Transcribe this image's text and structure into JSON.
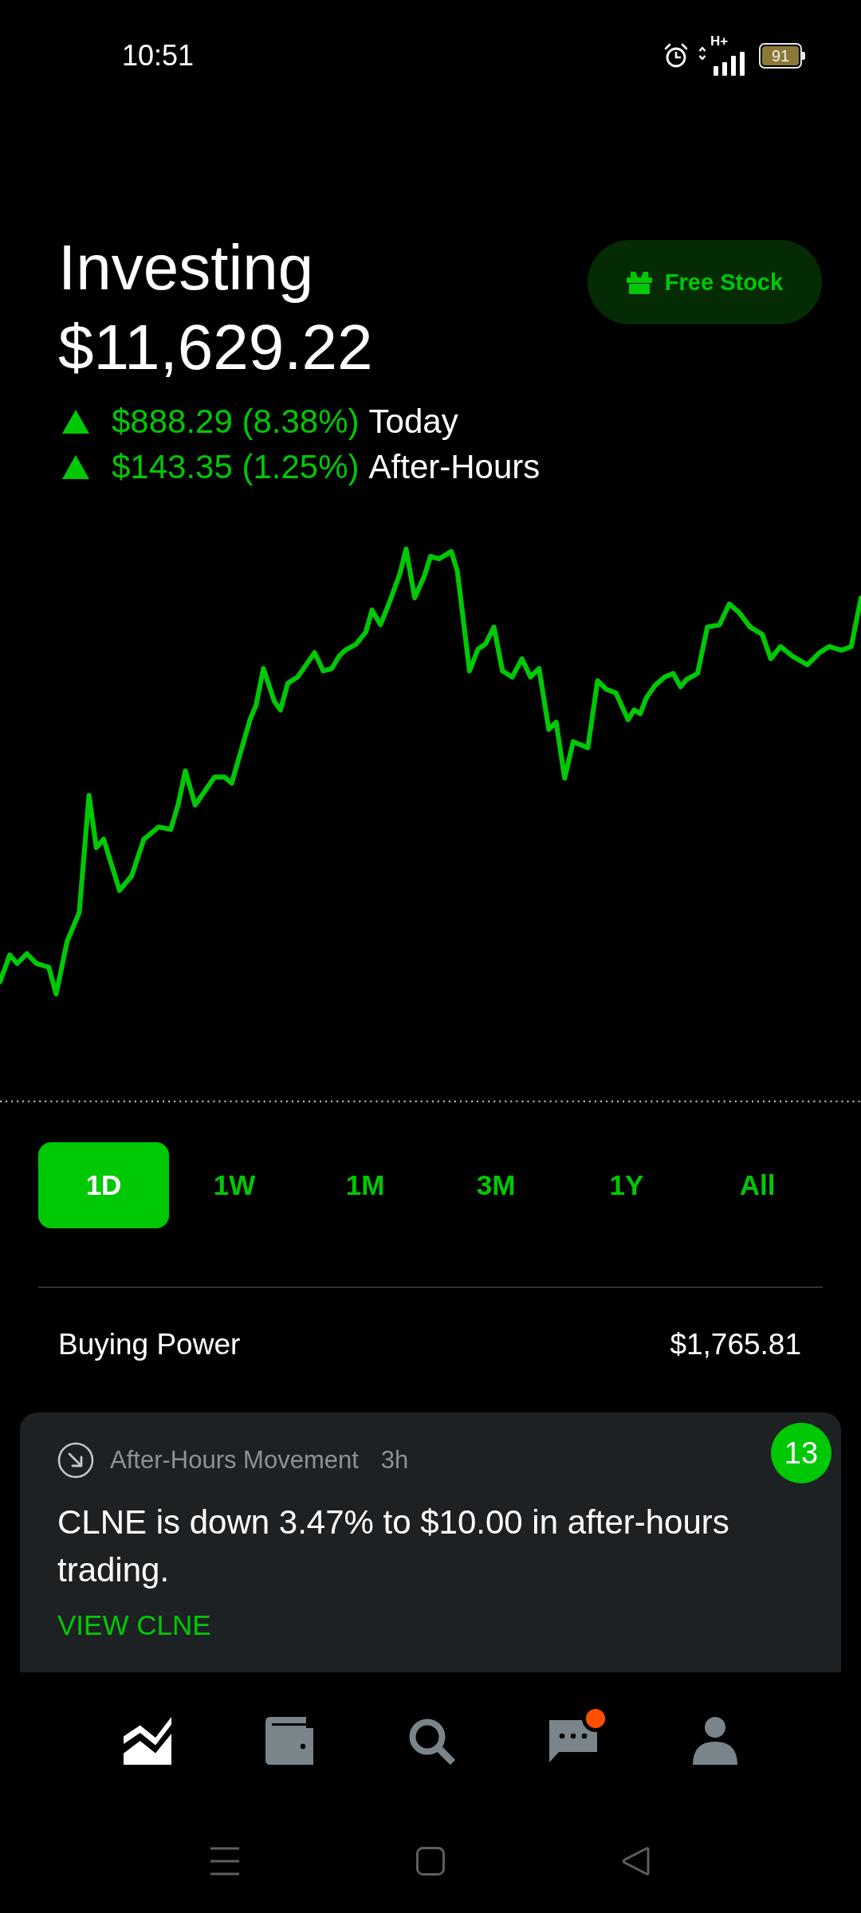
{
  "status_bar": {
    "time": "10:51",
    "network": "H+",
    "battery": "91"
  },
  "header": {
    "title": "Investing",
    "portfolio_value": "$11,629.22",
    "free_stock_button": "Free Stock"
  },
  "changes": [
    {
      "amount": "$888.29 (8.38%)",
      "label": "Today"
    },
    {
      "amount": "$143.35 (1.25%)",
      "label": "After-Hours"
    }
  ],
  "range_tabs": [
    {
      "label": "1D",
      "selected": true
    },
    {
      "label": "1W",
      "selected": false
    },
    {
      "label": "1M",
      "selected": false
    },
    {
      "label": "3M",
      "selected": false
    },
    {
      "label": "1Y",
      "selected": false
    },
    {
      "label": "All",
      "selected": false
    }
  ],
  "buying_power": {
    "label": "Buying Power",
    "value": "$1,765.81"
  },
  "notification_card": {
    "category": "After-Hours Movement",
    "age": "3h",
    "message": "CLNE is down 3.47% to $10.00 in after-hours trading.",
    "action": "VIEW CLNE",
    "badge": "13"
  },
  "bottom_nav": [
    {
      "kind": "chart",
      "selected": true,
      "badge_dot": false
    },
    {
      "kind": "wallet",
      "selected": false,
      "badge_dot": false
    },
    {
      "kind": "search",
      "selected": false,
      "badge_dot": false
    },
    {
      "kind": "messages",
      "selected": false,
      "badge_dot": true
    },
    {
      "kind": "account",
      "selected": false,
      "badge_dot": false
    }
  ]
}
